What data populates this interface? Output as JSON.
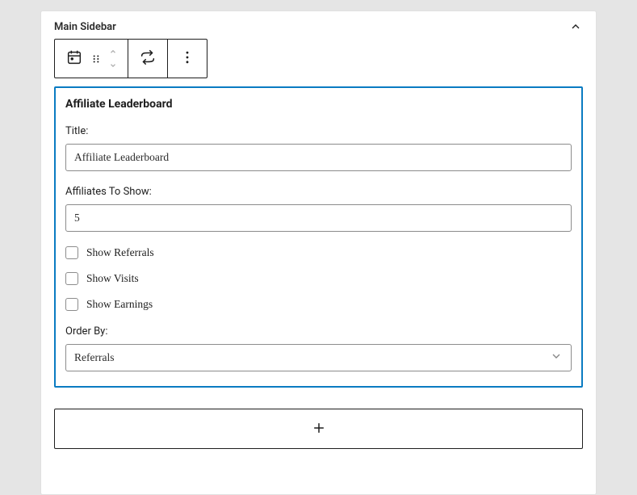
{
  "panel": {
    "title": "Main Sidebar"
  },
  "widget": {
    "title": "Affiliate Leaderboard",
    "fields": {
      "title_label": "Title:",
      "title_value": "Affiliate Leaderboard",
      "count_label": "Affiliates To Show:",
      "count_value": "5",
      "show_referrals_label": "Show Referrals",
      "show_visits_label": "Show Visits",
      "show_earnings_label": "Show Earnings",
      "order_by_label": "Order By:",
      "order_by_value": "Referrals"
    }
  },
  "icons": {
    "widget_type": "calendar-icon",
    "drag": "drag-handle-icon",
    "move_up": "chevron-up-icon",
    "move_down": "chevron-down-icon",
    "transform": "transform-arrow-icon",
    "options": "more-vertical-icon",
    "collapse": "chevron-up-icon",
    "add": "plus-icon"
  }
}
